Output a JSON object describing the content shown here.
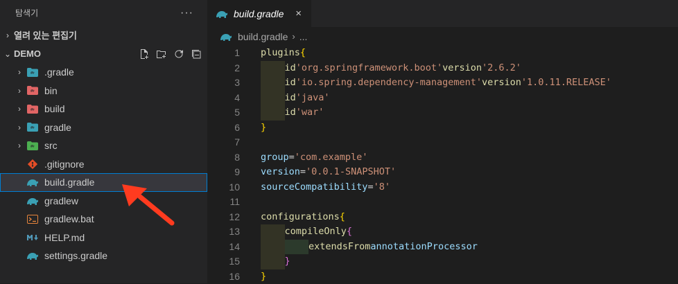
{
  "sidebar": {
    "title": "탐색기",
    "more": "···",
    "open_editors": "열려 있는 편집기",
    "project": "DEMO",
    "items": [
      {
        "label": ".gradle",
        "kind": "folder",
        "icon": "gradle-folder-icon",
        "color": "#3aa0b4"
      },
      {
        "label": "bin",
        "kind": "folder",
        "icon": "bin-folder-icon",
        "color": "#e16565"
      },
      {
        "label": "build",
        "kind": "folder",
        "icon": "build-folder-icon",
        "color": "#e16565"
      },
      {
        "label": "gradle",
        "kind": "folder",
        "icon": "gradle-folder-icon",
        "color": "#3aa0b4"
      },
      {
        "label": "src",
        "kind": "folder",
        "icon": "src-folder-icon",
        "color": "#4caf50"
      },
      {
        "label": ".gitignore",
        "kind": "file",
        "icon": "git-icon",
        "color": "#e44d26"
      },
      {
        "label": "build.gradle",
        "kind": "file",
        "icon": "gradle-elephant-icon",
        "color": "#3aa0b4",
        "selected": true
      },
      {
        "label": "gradlew",
        "kind": "file",
        "icon": "gradle-elephant-icon",
        "color": "#3aa0b4"
      },
      {
        "label": "gradlew.bat",
        "kind": "file",
        "icon": "terminal-icon",
        "color": "#e8853c"
      },
      {
        "label": "HELP.md",
        "kind": "file",
        "icon": "markdown-icon",
        "color": "#519aba"
      },
      {
        "label": "settings.gradle",
        "kind": "file",
        "icon": "gradle-elephant-icon",
        "color": "#3aa0b4"
      }
    ]
  },
  "tab": {
    "label": "build.gradle",
    "close": "×"
  },
  "breadcrumb": {
    "file": "build.gradle",
    "sep": "›",
    "rest": "..."
  },
  "code": {
    "line_numbers": [
      "1",
      "2",
      "3",
      "4",
      "5",
      "6",
      "7",
      "8",
      "9",
      "10",
      "11",
      "12",
      "13",
      "14",
      "15",
      "16"
    ],
    "l1_kw": "plugins",
    "l1_brace": "{",
    "l2_id": "id",
    "l2_str": "'org.springframework.boot'",
    "l2_ver": "version",
    "l2_vs": "'2.6.2'",
    "l3_id": "id",
    "l3_str": "'io.spring.dependency-management'",
    "l3_ver": "version",
    "l3_vs": "'1.0.11.RELEASE'",
    "l4_id": "id",
    "l4_str": "'java'",
    "l5_id": "id",
    "l5_str": "'war'",
    "l6_brace": "}",
    "l8_var": "group",
    "l8_op": "=",
    "l8_str": "'com.example'",
    "l9_var": "version",
    "l9_op": "=",
    "l9_str": "'0.0.1-SNAPSHOT'",
    "l10_var": "sourceCompatibility",
    "l10_op": "=",
    "l10_str": "'8'",
    "l12_kw": "configurations",
    "l12_brace": "{",
    "l13_kw": "compileOnly",
    "l13_brace": "{",
    "l14_kw": "extendsFrom",
    "l14_var": "annotationProcessor",
    "l15_brace": "}",
    "l16_brace": "}"
  },
  "colors": {
    "accent": "#007fd4",
    "arrow": "#ff3b1f"
  }
}
